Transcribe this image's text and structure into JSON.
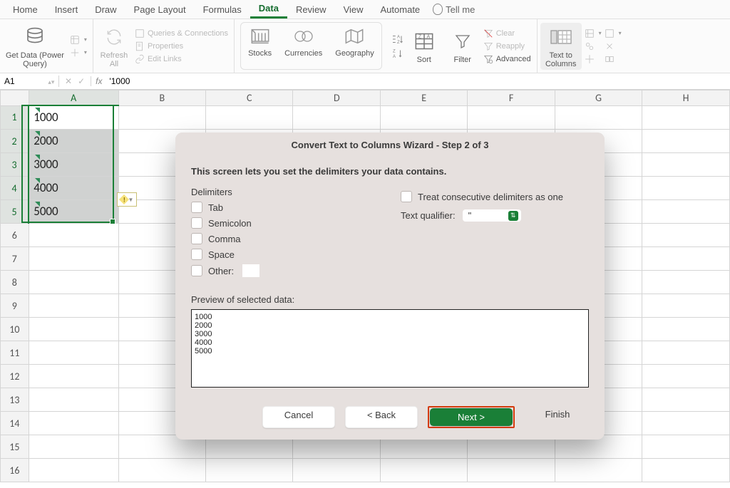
{
  "tabs": [
    "Home",
    "Insert",
    "Draw",
    "Page Layout",
    "Formulas",
    "Data",
    "Review",
    "View",
    "Automate"
  ],
  "active_tab": "Data",
  "tellme": "Tell me",
  "ribbon": {
    "getdata": "Get Data (Power\nQuery)",
    "refresh": "Refresh\nAll",
    "queries": "Queries & Connections",
    "properties": "Properties",
    "editlinks": "Edit Links",
    "stocks": "Stocks",
    "currencies": "Currencies",
    "geography": "Geography",
    "sort": "Sort",
    "filter": "Filter",
    "clear": "Clear",
    "reapply": "Reapply",
    "advanced": "Advanced",
    "text_to_columns": "Text to\nColumns"
  },
  "formula_bar": {
    "name": "A1",
    "formula": "'1000"
  },
  "columns": [
    "A",
    "B",
    "C",
    "D",
    "E",
    "F",
    "G",
    "H"
  ],
  "rows": 16,
  "cells": {
    "A1": "1000",
    "A2": "2000",
    "A3": "3000",
    "A4": "4000",
    "A5": "5000"
  },
  "dialog": {
    "title": "Convert Text to Columns Wizard - Step 2 of 3",
    "lead": "This screen lets you set the delimiters your data contains.",
    "delimiters_label": "Delimiters",
    "opts": {
      "tab": "Tab",
      "semicolon": "Semicolon",
      "comma": "Comma",
      "space": "Space",
      "other": "Other:"
    },
    "treat": "Treat consecutive delimiters as one",
    "qualifier_label": "Text qualifier:",
    "qualifier_value": "\"",
    "preview_label": "Preview of selected data:",
    "preview_lines": [
      "1000",
      "2000",
      "3000",
      "4000",
      "5000"
    ],
    "buttons": {
      "cancel": "Cancel",
      "back": "< Back",
      "next": "Next >",
      "finish": "Finish"
    }
  }
}
